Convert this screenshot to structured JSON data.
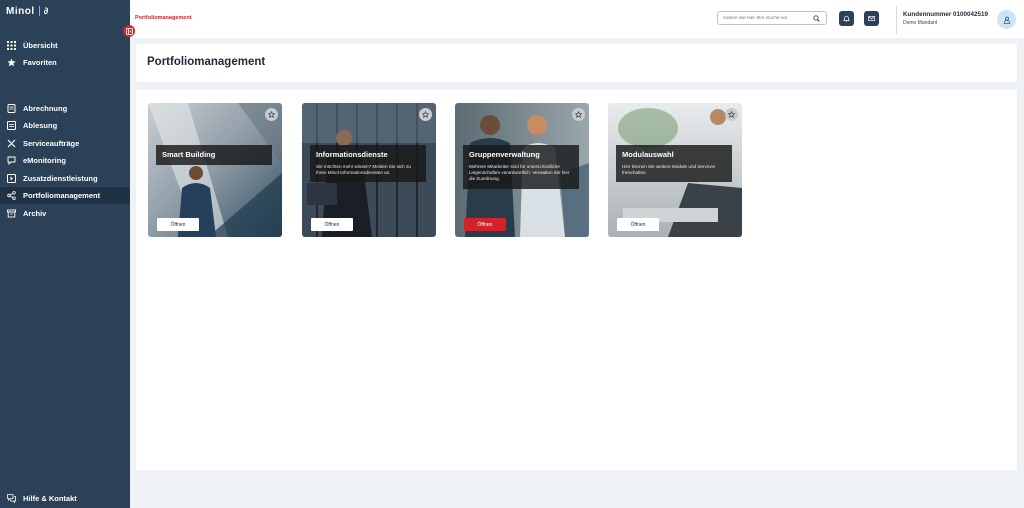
{
  "app": {
    "logo_text": "Minol",
    "logo_mark": "∂"
  },
  "sidebar": {
    "items": [
      {
        "label": "Übersicht",
        "icon": "grid-icon"
      },
      {
        "label": "Favoriten",
        "icon": "star-icon"
      },
      {
        "label": "Abrechnung",
        "icon": "document-icon"
      },
      {
        "label": "Ablesung",
        "icon": "meter-icon"
      },
      {
        "label": "Serviceaufträge",
        "icon": "tools-icon"
      },
      {
        "label": "eMonitoring",
        "icon": "chat-icon"
      },
      {
        "label": "Zusatzdienstleistung",
        "icon": "plus-box-icon"
      },
      {
        "label": "Portfoliomanagement",
        "icon": "share-icon"
      },
      {
        "label": "Archiv",
        "icon": "archive-icon"
      }
    ],
    "active": "Portfoliomanagement",
    "footer": {
      "label": "Hilfe & Kontakt",
      "icon": "help-chat-icon"
    }
  },
  "header": {
    "breadcrumb": "Portfoliomanagement",
    "search_placeholder": "Geben Sie hier Ihre Suche ein",
    "customer_number": "Kundennummer 0100042519",
    "customer_name": "Demo Mandant"
  },
  "page": {
    "title": "Portfoliomanagement",
    "cards": [
      {
        "title": "Smart Building",
        "description": "",
        "button": "Öffnen",
        "primary": false
      },
      {
        "title": "Informationsdienste",
        "description": "Sie möchten mehr wissen? Melden Sie sich zu Ihren Minol-Informationsdiensten an.",
        "button": "Öffnen",
        "primary": false
      },
      {
        "title": "Gruppenverwaltung",
        "description": "Mehrere Mitarbeiter sind für unterschiedliche Liegenschaften verantwortlich. Verwalten Sie hier die Zuordnung.",
        "button": "Öffnen",
        "primary": true
      },
      {
        "title": "Modulauswahl",
        "description": "Hier können Sie weitere Module und Services freischalten.",
        "button": "Öffnen",
        "primary": false
      }
    ]
  },
  "colors": {
    "sidebar": "#2b4157",
    "accent": "#d3232a",
    "background": "#eef1f5"
  }
}
